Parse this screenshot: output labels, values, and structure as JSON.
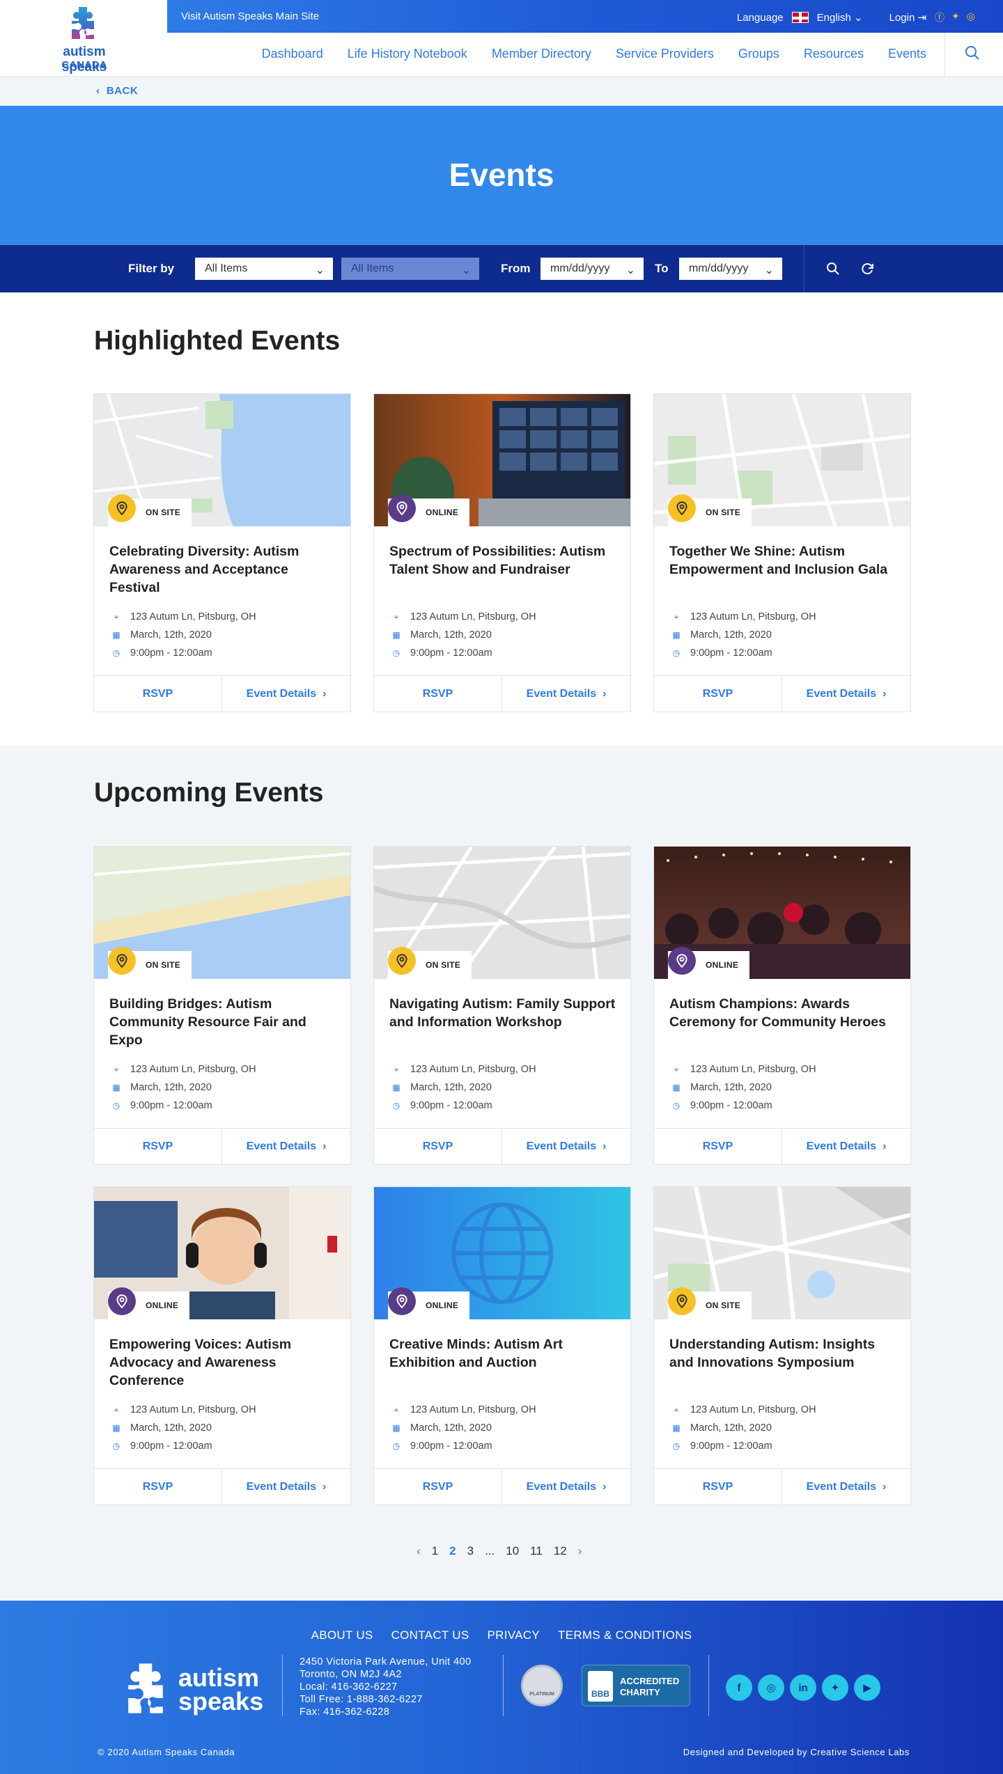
{
  "topbar": {
    "visit_link": "Visit Autism Speaks Main Site",
    "language_label": "Language",
    "language_value": "English",
    "login_label": "Login"
  },
  "logo": {
    "line1": "autism speaks",
    "line2": "CANADA"
  },
  "nav": {
    "items": [
      "Dashboard",
      "Life History Notebook",
      "Member Directory",
      "Service Providers",
      "Groups",
      "Resources",
      "Events"
    ]
  },
  "back_label": "BACK",
  "hero": {
    "title": "Events"
  },
  "filter": {
    "label": "Filter by",
    "select1": "All Items",
    "select2": "All Items",
    "from_label": "From",
    "from_placeholder": "mm/dd/yyyy",
    "to_label": "To",
    "to_placeholder": "mm/dd/yyyy"
  },
  "highlighted": {
    "title": "Highlighted Events",
    "events": [
      {
        "title": "Celebrating Diversity: Autism Awareness and Acceptance Festival",
        "badge": "ON SITE",
        "address": "123 Autum Ln, Pitsburg, OH",
        "date": "March, 12th, 2020",
        "time": "9:00pm - 12:00am",
        "rsvp": "RSVP",
        "details": "Event Details"
      },
      {
        "title": "Spectrum of Possibilities: Autism Talent Show and Fundraiser",
        "badge": "ONLINE",
        "address": "123 Autum Ln, Pitsburg, OH",
        "date": "March, 12th, 2020",
        "time": "9:00pm - 12:00am",
        "rsvp": "RSVP",
        "details": "Event Details"
      },
      {
        "title": "Together We Shine: Autism Empowerment and Inclusion Gala",
        "badge": "ON SITE",
        "address": "123 Autum Ln, Pitsburg, OH",
        "date": "March, 12th, 2020",
        "time": "9:00pm - 12:00am",
        "rsvp": "RSVP",
        "details": "Event Details"
      }
    ]
  },
  "upcoming": {
    "title": "Upcoming Events",
    "events": [
      {
        "title": "Building Bridges: Autism Community Resource Fair and Expo",
        "badge": "ON SITE",
        "address": "123 Autum Ln, Pitsburg, OH",
        "date": "March, 12th, 2020",
        "time": "9:00pm - 12:00am",
        "rsvp": "RSVP",
        "details": "Event Details"
      },
      {
        "title": "Navigating Autism: Family Support and Information Workshop",
        "badge": "ON SITE",
        "address": "123 Autum Ln, Pitsburg, OH",
        "date": "March, 12th, 2020",
        "time": "9:00pm - 12:00am",
        "rsvp": "RSVP",
        "details": "Event Details"
      },
      {
        "title": "Autism Champions: Awards Ceremony for Community Heroes",
        "badge": "ONLINE",
        "address": "123 Autum Ln, Pitsburg, OH",
        "date": "March, 12th, 2020",
        "time": "9:00pm - 12:00am",
        "rsvp": "RSVP",
        "details": "Event Details"
      },
      {
        "title": "Empowering Voices: Autism Advocacy and Awareness Conference",
        "badge": "ONLINE",
        "address": "123 Autum Ln, Pitsburg, OH",
        "date": "March, 12th, 2020",
        "time": "9:00pm - 12:00am",
        "rsvp": "RSVP",
        "details": "Event Details"
      },
      {
        "title": "Creative Minds: Autism Art Exhibition and Auction",
        "badge": "ONLINE",
        "address": "123 Autum Ln, Pitsburg, OH",
        "date": "March, 12th, 2020",
        "time": "9:00pm - 12:00am",
        "rsvp": "RSVP",
        "details": "Event Details"
      },
      {
        "title": "Understanding Autism: Insights and Innovations Symposium",
        "badge": "ON SITE",
        "address": "123 Autum Ln, Pitsburg, OH",
        "date": "March, 12th, 2020",
        "time": "9:00pm - 12:00am",
        "rsvp": "RSVP",
        "details": "Event Details"
      }
    ]
  },
  "pagination": {
    "pages": [
      "1",
      "2",
      "3",
      "...",
      "10",
      "11",
      "12"
    ],
    "current": "2"
  },
  "footer": {
    "links": [
      "ABOUT US",
      "CONTACT US",
      "PRIVACY",
      "TERMS & CONDITIONS"
    ],
    "logo_line1": "autism",
    "logo_line2": "speaks",
    "address": [
      "2450 Victoria Park Avenue, Unit 400",
      "Toronto, ON M2J 4A2",
      "Local: 416-362-6227",
      "Toll Free: 1-888-362-6227",
      "Fax: 416-362-6228"
    ],
    "seal_text": "PLATINUM",
    "bbb_logo": "BBB",
    "bbb_text": "ACCREDITED CHARITY",
    "copyright": "© 2020 Autism Speaks Canada",
    "developer": "Designed and Developed by Creative Science Labs"
  },
  "colors": {
    "accent": "#2f7be6",
    "hero": "#3188ea",
    "filter_bar": "#0e2b8f",
    "onsite": "#f7c125",
    "online": "#5a3b87"
  }
}
